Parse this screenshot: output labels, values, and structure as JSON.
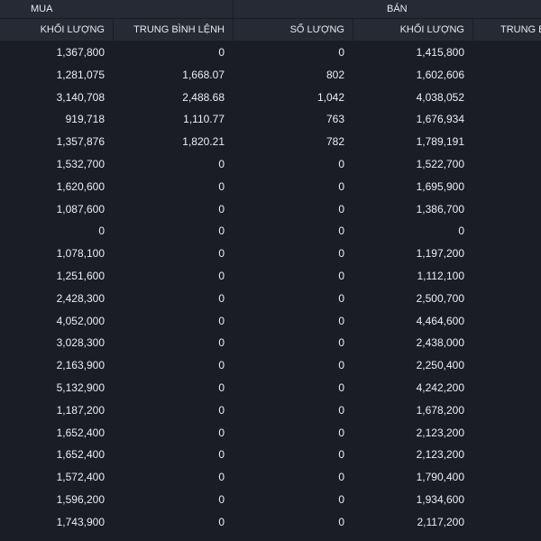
{
  "groups": {
    "buy": "MUA",
    "sell": "BÁN"
  },
  "columns": [
    "KHỐI LƯỢNG",
    "TRUNG BÌNH LỆNH",
    "SỐ LƯỢNG",
    "KHỐI LƯỢNG",
    "TRUNG BÌ"
  ],
  "rows": [
    [
      "1,367,800",
      "0",
      "0",
      "1,415,800"
    ],
    [
      "1,281,075",
      "1,668.07",
      "802",
      "1,602,606"
    ],
    [
      "3,140,708",
      "2,488.68",
      "1,042",
      "4,038,052"
    ],
    [
      "919,718",
      "1,110.77",
      "763",
      "1,676,934"
    ],
    [
      "1,357,876",
      "1,820.21",
      "782",
      "1,789,191"
    ],
    [
      "1,532,700",
      "0",
      "0",
      "1,522,700"
    ],
    [
      "1,620,600",
      "0",
      "0",
      "1,695,900"
    ],
    [
      "1,087,600",
      "0",
      "0",
      "1,386,700"
    ],
    [
      "0",
      "0",
      "0",
      "0"
    ],
    [
      "1,078,100",
      "0",
      "0",
      "1,197,200"
    ],
    [
      "1,251,600",
      "0",
      "0",
      "1,112,100"
    ],
    [
      "2,428,300",
      "0",
      "0",
      "2,500,700"
    ],
    [
      "4,052,000",
      "0",
      "0",
      "4,464,600"
    ],
    [
      "3,028,300",
      "0",
      "0",
      "2,438,000"
    ],
    [
      "2,163,900",
      "0",
      "0",
      "2,250,400"
    ],
    [
      "5,132,900",
      "0",
      "0",
      "4,242,200"
    ],
    [
      "1,187,200",
      "0",
      "0",
      "1,678,200"
    ],
    [
      "1,652,400",
      "0",
      "0",
      "2,123,200"
    ],
    [
      "1,652,400",
      "0",
      "0",
      "2,123,200"
    ],
    [
      "1,572,400",
      "0",
      "0",
      "1,790,400"
    ],
    [
      "1,596,200",
      "0",
      "0",
      "1,934,600"
    ],
    [
      "1,743,900",
      "0",
      "0",
      "2,117,200"
    ]
  ]
}
